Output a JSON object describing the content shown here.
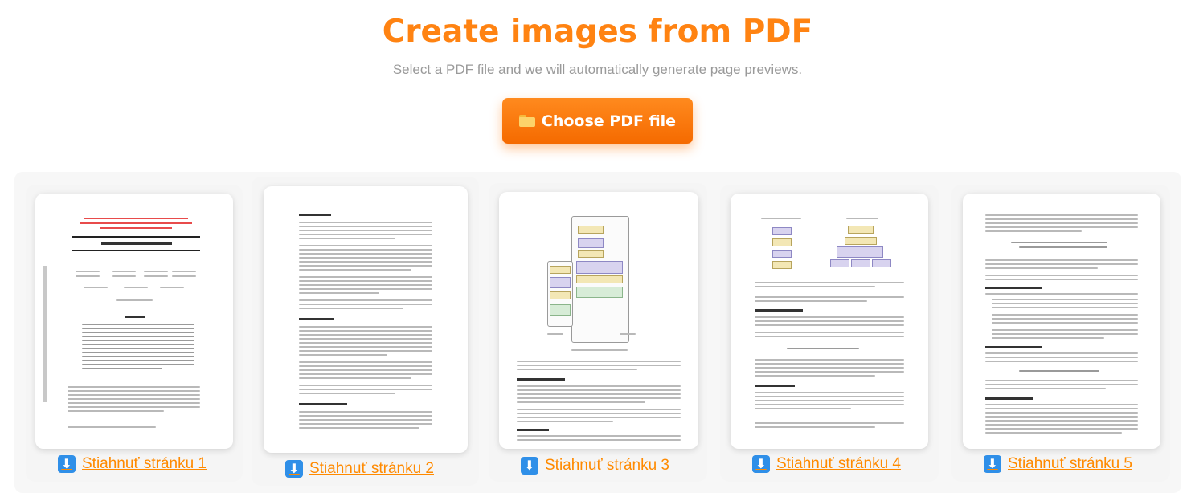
{
  "header": {
    "title": "Create images from PDF",
    "subtitle": "Select a PDF file and we will automatically generate page previews."
  },
  "upload": {
    "button_label": "Choose PDF file",
    "icon": "folder-icon"
  },
  "pages": [
    {
      "download_label": "Stiahnuť stránku 1",
      "icon": "download-icon"
    },
    {
      "download_label": "Stiahnuť stránku 2",
      "icon": "download-icon"
    },
    {
      "download_label": "Stiahnuť stránku 3",
      "icon": "download-icon"
    },
    {
      "download_label": "Stiahnuť stránku 4",
      "icon": "download-icon"
    },
    {
      "download_label": "Stiahnuť stránku 5",
      "icon": "download-icon"
    }
  ],
  "colors": {
    "accent": "#ff8312",
    "button": "#f57a0a",
    "link": "#ff8a00",
    "download_icon": "#2f8fe8"
  }
}
